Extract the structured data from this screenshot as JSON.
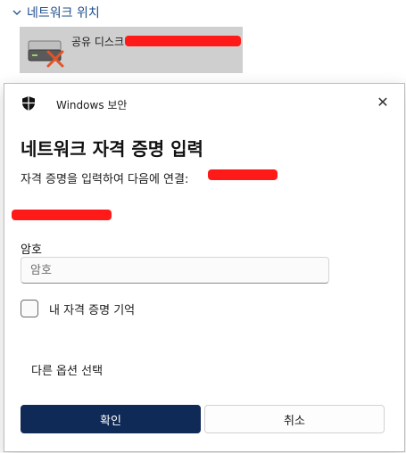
{
  "explorer": {
    "group_title": "네트워크 위치",
    "drive_label": "공유 디스크"
  },
  "dialog": {
    "app_title": "Windows 보안",
    "heading": "네트워크 자격 증명 입력",
    "description": "자격 증명을 입력하여 다음에 연결:",
    "password_label": "암호",
    "password_placeholder": "암호",
    "remember_label": "내 자격 증명 기억",
    "more_options": "다른 옵션 선택",
    "ok_label": "확인",
    "cancel_label": "취소",
    "close_glyph": "✕"
  },
  "colors": {
    "primary_button": "#0f2a57",
    "redaction": "#ff1a1a",
    "link_blue": "#1e4e8c"
  }
}
